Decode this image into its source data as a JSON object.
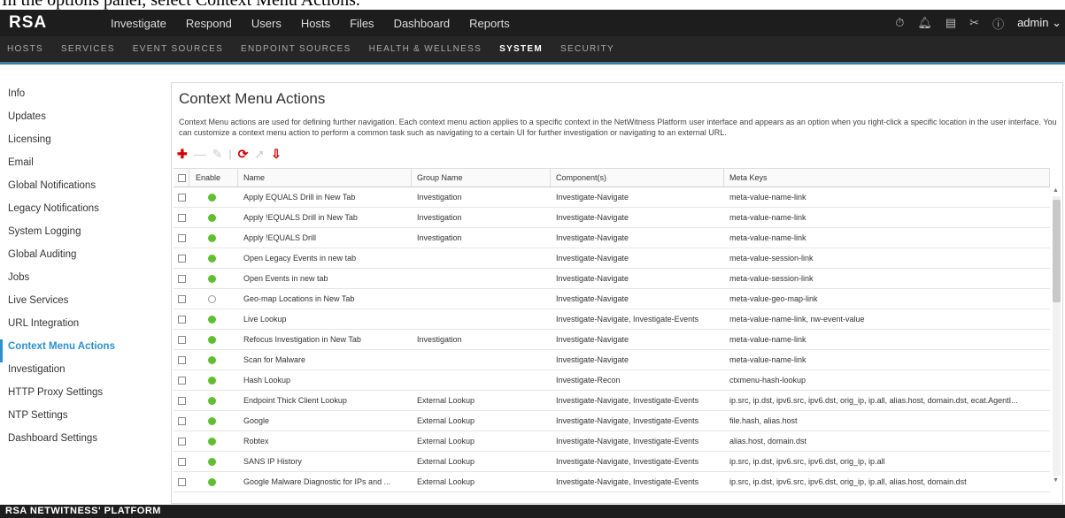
{
  "caption": "In the options panel, select Context Menu Actions.",
  "topnav": {
    "logo": "RSA",
    "items": [
      "Investigate",
      "Respond",
      "Users",
      "Hosts",
      "Files",
      "Dashboard",
      "Reports"
    ],
    "user": "admin ⌄"
  },
  "subnav": {
    "items": [
      "HOSTS",
      "SERVICES",
      "EVENT SOURCES",
      "ENDPOINT SOURCES",
      "HEALTH & WELLNESS",
      "SYSTEM",
      "SECURITY"
    ],
    "active": "SYSTEM"
  },
  "sidebar": {
    "items": [
      "Info",
      "Updates",
      "Licensing",
      "Email",
      "Global Notifications",
      "Legacy Notifications",
      "System Logging",
      "Global Auditing",
      "Jobs",
      "Live Services",
      "URL Integration",
      "Context Menu Actions",
      "Investigation",
      "HTTP Proxy Settings",
      "NTP Settings",
      "Dashboard Settings"
    ],
    "active": "Context Menu Actions"
  },
  "panel": {
    "title": "Context Menu Actions",
    "description": "Context Menu actions are used for defining further navigation. Each context menu action applies to a specific context in the NetWitness Platform user interface and appears as an option when you right-click a specific location in the user interface. You can customize a context menu action to perform a common task such as navigating to a certain UI for further investigation or navigating to an external URL."
  },
  "table": {
    "headers": [
      "Enable",
      "Name",
      "Group Name",
      "Component(s)",
      "Meta Keys"
    ],
    "rows": [
      {
        "enabled": true,
        "name": "Apply EQUALS Drill in New Tab",
        "group": "Investigation",
        "components": "Investigate-Navigate",
        "meta": "meta-value-name-link"
      },
      {
        "enabled": true,
        "name": "Apply !EQUALS Drill in New Tab",
        "group": "Investigation",
        "components": "Investigate-Navigate",
        "meta": "meta-value-name-link"
      },
      {
        "enabled": true,
        "name": "Apply !EQUALS Drill",
        "group": "Investigation",
        "components": "Investigate-Navigate",
        "meta": "meta-value-name-link"
      },
      {
        "enabled": true,
        "name": "Open Legacy Events in new tab",
        "group": "",
        "components": "Investigate-Navigate",
        "meta": "meta-value-session-link"
      },
      {
        "enabled": true,
        "name": "Open Events in new tab",
        "group": "",
        "components": "Investigate-Navigate",
        "meta": "meta-value-session-link"
      },
      {
        "enabled": false,
        "name": "Geo-map Locations in New Tab",
        "group": "",
        "components": "Investigate-Navigate",
        "meta": "meta-value-geo-map-link"
      },
      {
        "enabled": true,
        "name": "Live Lookup",
        "group": "",
        "components": "Investigate-Navigate, Investigate-Events",
        "meta": "meta-value-name-link, nw-event-value"
      },
      {
        "enabled": true,
        "name": "Refocus Investigation in New Tab",
        "group": "Investigation",
        "components": "Investigate-Navigate",
        "meta": "meta-value-name-link"
      },
      {
        "enabled": true,
        "name": "Scan for Malware",
        "group": "",
        "components": "Investigate-Navigate",
        "meta": "meta-value-name-link"
      },
      {
        "enabled": true,
        "name": "Hash Lookup",
        "group": "",
        "components": "Investigate-Recon",
        "meta": "ctxmenu-hash-lookup"
      },
      {
        "enabled": true,
        "name": "Endpoint Thick Client Lookup",
        "group": "External Lookup",
        "components": "Investigate-Navigate, Investigate-Events",
        "meta": "ip.src, ip.dst, ipv6.src, ipv6.dst, orig_ip, ip.all, alias.host, domain.dst, ecat.AgentI..."
      },
      {
        "enabled": true,
        "name": "Google",
        "group": "External Lookup",
        "components": "Investigate-Navigate, Investigate-Events",
        "meta": "file.hash, alias.host"
      },
      {
        "enabled": true,
        "name": "Robtex",
        "group": "External Lookup",
        "components": "Investigate-Navigate, Investigate-Events",
        "meta": "alias.host, domain.dst"
      },
      {
        "enabled": true,
        "name": "SANS IP History",
        "group": "External Lookup",
        "components": "Investigate-Navigate, Investigate-Events",
        "meta": "ip.src, ip.dst, ipv6.src, ipv6.dst, orig_ip, ip.all"
      },
      {
        "enabled": true,
        "name": "Google Malware Diagnostic for IPs and ...",
        "group": "External Lookup",
        "components": "Investigate-Navigate, Investigate-Events",
        "meta": "ip.src, ip.dst, ipv6.src, ipv6.dst, orig_ip, ip.all, alias.host, domain.dst"
      }
    ]
  },
  "footer": "RSA NETWITNESS' PLATFORM",
  "colors": {
    "accent": "#2c8fcf",
    "enabled": "#5fbf30",
    "danger": "#d40000"
  },
  "icons": [
    "timer-icon",
    "bell-icon",
    "notes-icon",
    "tools-icon",
    "help-icon",
    "add-icon",
    "remove-icon",
    "edit-icon",
    "refresh-icon",
    "export-icon",
    "import-icon"
  ]
}
